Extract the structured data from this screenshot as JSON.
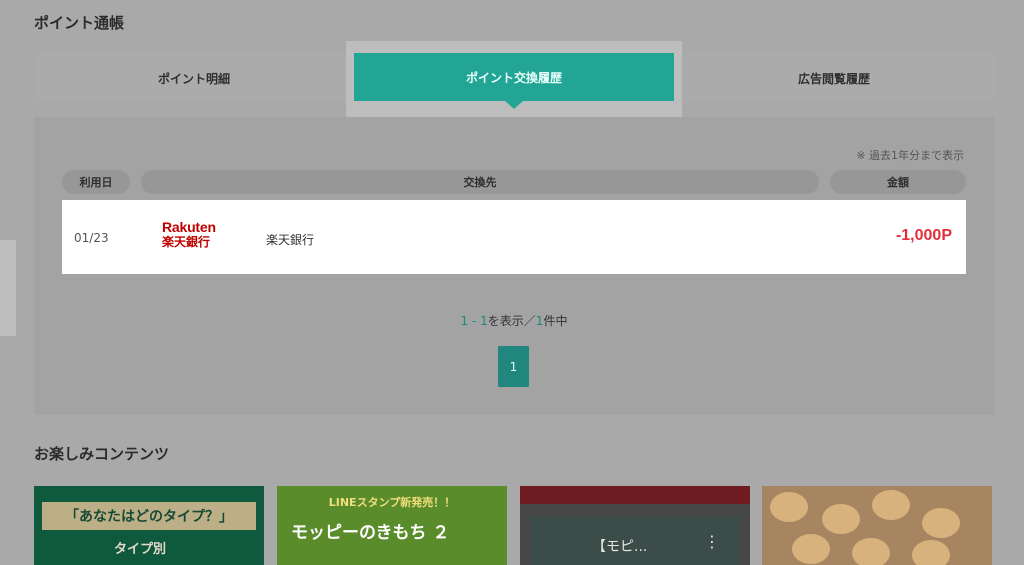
{
  "header": {
    "title": "ポイント通帳"
  },
  "tabs": [
    {
      "label": "ポイント明細"
    },
    {
      "label": "ポイント交換履歴"
    },
    {
      "label": "広告閲覧履歴"
    }
  ],
  "panel": {
    "note": "※ 過去1年分まで表示",
    "columns": {
      "date": "利用日",
      "destination": "交換先",
      "amount": "金額"
    },
    "rows": [
      {
        "date": "01/23",
        "logo_en": "Rakuten",
        "logo_ja": "楽天銀行",
        "destination": "楽天銀行",
        "amount": "-1,000P"
      }
    ],
    "count": {
      "start": "1",
      "sep": " - ",
      "end": "1",
      "mid": "を表示／",
      "total": "1",
      "suffix": "件中"
    },
    "pager": {
      "current": "1"
    }
  },
  "section2": {
    "title": "お楽しみコンテンツ"
  },
  "cards": [
    {
      "banner": "「あなたはどのタイプ？」",
      "sub": "タイプ別"
    },
    {
      "title": "LINEスタンプ新発売！！",
      "main": "モッピーのきもち ２"
    },
    {
      "text": "【モピ..."
    },
    {}
  ],
  "colors": {
    "accent": "#23a596",
    "negative": "#e0303a",
    "brand_red": "#bf0000"
  }
}
